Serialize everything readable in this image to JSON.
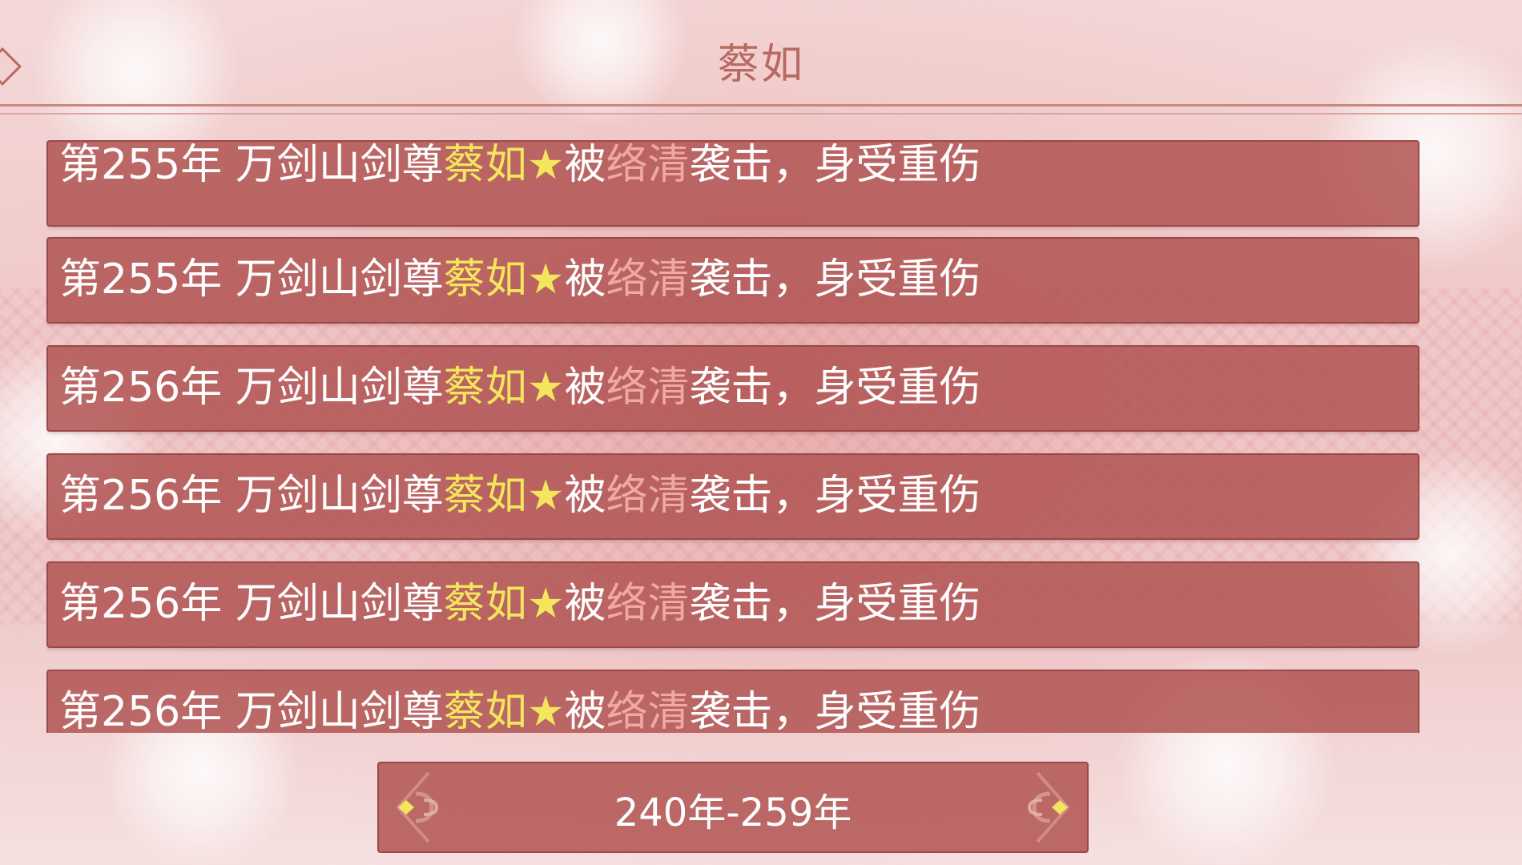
{
  "header": {
    "title": "蔡如"
  },
  "events": [
    {
      "prefix": "第255年 万剑山剑尊",
      "name": "蔡如",
      "star": "★",
      "mid": "被",
      "attacker": "络清",
      "suffix": "袭击，身受重伤"
    },
    {
      "prefix": "第255年 万剑山剑尊",
      "name": "蔡如",
      "star": "★",
      "mid": "被",
      "attacker": "络清",
      "suffix": "袭击，身受重伤"
    },
    {
      "prefix": "第256年 万剑山剑尊",
      "name": "蔡如",
      "star": "★",
      "mid": "被",
      "attacker": "络清",
      "suffix": "袭击，身受重伤"
    },
    {
      "prefix": "第256年 万剑山剑尊",
      "name": "蔡如",
      "star": "★",
      "mid": "被",
      "attacker": "络清",
      "suffix": "袭击，身受重伤"
    },
    {
      "prefix": "第256年 万剑山剑尊",
      "name": "蔡如",
      "star": "★",
      "mid": "被",
      "attacker": "络清",
      "suffix": "袭击，身受重伤"
    },
    {
      "prefix": "第256年 万剑山剑尊",
      "name": "蔡如",
      "star": "★",
      "mid": "被",
      "attacker": "络清",
      "suffix": "袭击，身受重伤"
    }
  ],
  "pager": {
    "range_label": "240年-259年"
  },
  "icons": {
    "back": "back-arrow-icon",
    "prev": "prev-page-icon",
    "next": "next-page-icon"
  },
  "colors": {
    "row_bg": "#b05452",
    "name_highlight": "#f3e65c",
    "attacker_highlight": "#f0a8a6",
    "title": "#b86a62"
  }
}
